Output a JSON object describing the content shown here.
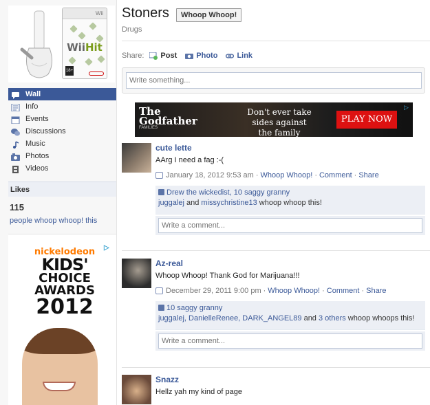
{
  "page": {
    "title": "Stoners",
    "like_button": "Whoop Whoop!",
    "category": "Drugs"
  },
  "profile_box": {
    "brand_top": "Wii",
    "game_title_a": "Wii",
    "game_title_b": "Hit",
    "rating": "18+"
  },
  "sidebar": {
    "items": [
      {
        "label": "Wall",
        "icon": "wall-icon"
      },
      {
        "label": "Info",
        "icon": "info-icon"
      },
      {
        "label": "Events",
        "icon": "events-icon"
      },
      {
        "label": "Discussions",
        "icon": "discussions-icon"
      },
      {
        "label": "Music",
        "icon": "music-icon"
      },
      {
        "label": "Photos",
        "icon": "photos-icon"
      },
      {
        "label": "Videos",
        "icon": "videos-icon"
      }
    ],
    "likes_heading": "Likes",
    "likes_count": "115",
    "likes_text": "people whoop whoop! this"
  },
  "left_ad": {
    "brand": "nickelodeon",
    "line1": "KIDS'",
    "line2": "CHOICE",
    "line3": "AWARDS",
    "year": "2012"
  },
  "composer": {
    "share_label": "Share:",
    "options": [
      "Post",
      "Photo",
      "Link"
    ],
    "placeholder": "Write something..."
  },
  "banner_ad": {
    "title": "The Godfather",
    "subtitle": "FAMILIES",
    "tagline": "Don't ever take sides against the family",
    "cta": "PLAY NOW"
  },
  "posts": [
    {
      "author": "cute lette",
      "message": "AArg I need a fag :-(",
      "timestamp": "January 18, 2012 9:53 am",
      "via": "Whoop Whoop!",
      "comment": "Comment",
      "share": "Share",
      "likers_line1": "Drew the wickedist, 10 saggy granny",
      "likers_line2_links": "juggalej",
      "likers_line2_and": " and ",
      "likers_line2_link2": "missychristine13",
      "likers_line2_tail": " whoop whoop this!",
      "comment_placeholder": "Write a comment..."
    },
    {
      "author": "Az-real",
      "message": "Whoop Whoop! Thank God for Marijuana!!!",
      "timestamp": "December 29, 2011 9:00 pm",
      "via": "Whoop Whoop!",
      "comment": "Comment",
      "share": "Share",
      "likers_line1": "10 saggy granny",
      "likers_line2_links": "juggalej, DanielleRenee, DARK_ANGEL89",
      "likers_line2_and": " and ",
      "likers_line2_link2": "3 others",
      "likers_line2_tail": " whoop whoops this!",
      "comment_placeholder": "Write a comment..."
    },
    {
      "author": "Snazz",
      "message": "Hellz yah my kind of page"
    }
  ],
  "colors": {
    "link": "#3b5998",
    "nav_active": "#3b5998",
    "likes_bg": "#eceff5"
  }
}
